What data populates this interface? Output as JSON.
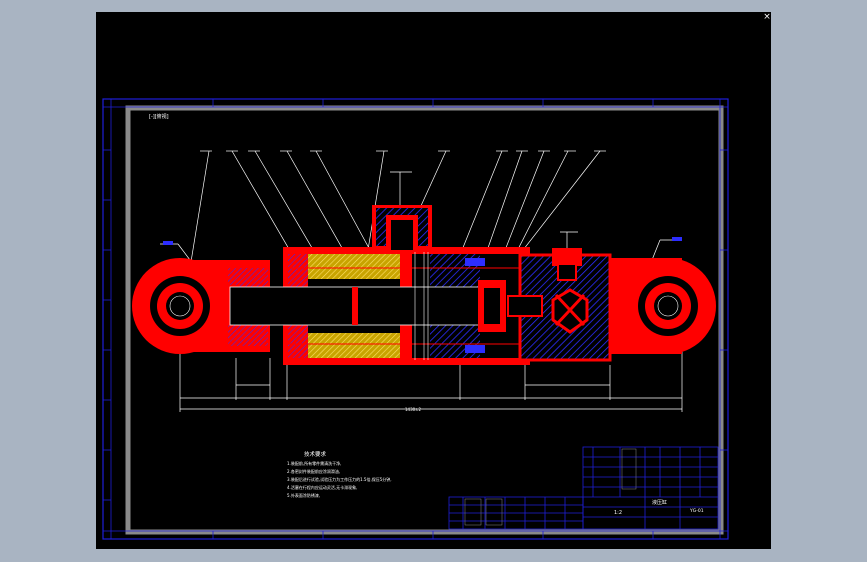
{
  "window": {
    "close_glyph": "×"
  },
  "drawing": {
    "view_label": "[-][俯视]",
    "tech_req_title": "技术要求",
    "tech_req_lines": [
      "1.装配前,所有零件需清洗干净,",
      "2.各密封件装配前应涂润滑油,",
      "3.装配后进行试验,试验压力为工作压力的1.5倍,保压5分钟,",
      "4.活塞在行程内应运动灵活,无卡滞现象,",
      "5.外表面涂防锈漆,"
    ],
    "overall_dim": "1430±2",
    "title_block_main": "液压缸",
    "title_block_code": "YG-01",
    "scale_text": "1:2",
    "colors": {
      "border": "#1f1fd8",
      "section": "#ff0000",
      "hatch": "#2d2dff",
      "dim_lines": "#ffffff",
      "accent_yellow": "#ffd400"
    }
  }
}
